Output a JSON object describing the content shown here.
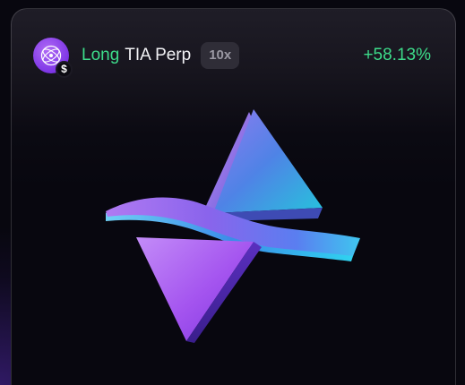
{
  "position": {
    "direction": "Long",
    "market": "TIA Perp",
    "leverage": "10x",
    "pnl": "+58.13%"
  },
  "icons": {
    "token": "tia-token-icon",
    "badge": "dollar-badge-icon"
  },
  "badge_symbol": "$",
  "colors": {
    "accent_green": "#3ddc8a",
    "token_purple": "#8a3fec",
    "background": "#08070f"
  }
}
